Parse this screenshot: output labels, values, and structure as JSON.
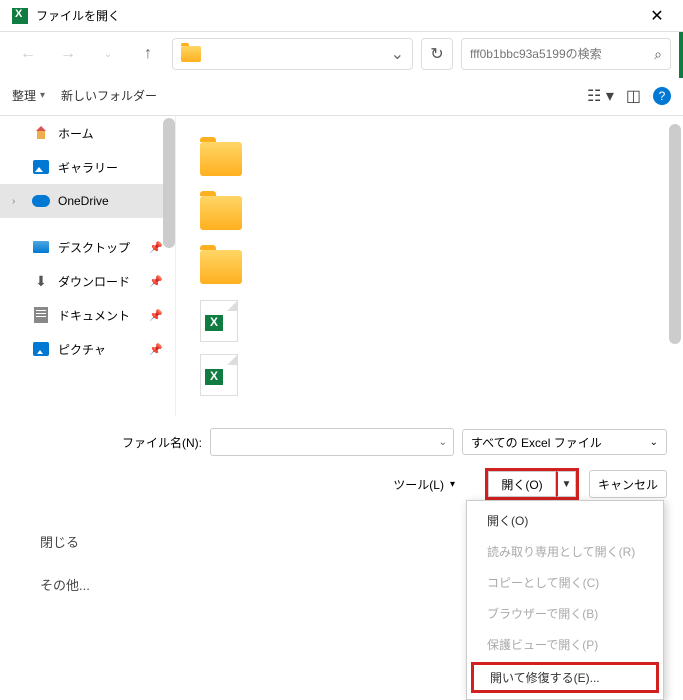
{
  "title": "ファイルを開く",
  "search": {
    "placeholder": "fff0b1bbc93a5199の検索"
  },
  "toolbar": {
    "organize": "整理",
    "newfolder": "新しいフォルダー"
  },
  "sidebar": [
    {
      "label": "ホーム",
      "icon": "house"
    },
    {
      "label": "ギャラリー",
      "icon": "gallery"
    },
    {
      "label": "OneDrive",
      "icon": "onedrive",
      "selected": true,
      "expandable": true
    },
    {
      "sep": true
    },
    {
      "label": "デスクトップ",
      "icon": "desktop",
      "pinned": true
    },
    {
      "label": "ダウンロード",
      "icon": "download",
      "pinned": true
    },
    {
      "label": "ドキュメント",
      "icon": "doc",
      "pinned": true
    },
    {
      "label": "ピクチャ",
      "icon": "pic",
      "pinned": true
    }
  ],
  "files": [
    {
      "type": "folder"
    },
    {
      "type": "folder"
    },
    {
      "type": "folder"
    },
    {
      "type": "excel"
    },
    {
      "type": "excel"
    }
  ],
  "filename_label": "ファイル名(N):",
  "filetype": "すべての Excel ファイル",
  "tools_label": "ツール(L)",
  "open_label": "開く(O)",
  "cancel_label": "キャンセル",
  "menu": [
    {
      "label": "開く(O)"
    },
    {
      "label": "読み取り専用として開く(R)",
      "disabled": true
    },
    {
      "label": "コピーとして開く(C)",
      "disabled": true
    },
    {
      "label": "ブラウザーで開く(B)",
      "disabled": true
    },
    {
      "label": "保護ビューで開く(P)",
      "disabled": true
    },
    {
      "label": "開いて修復する(E)...",
      "highlighted": true
    }
  ],
  "backstage": {
    "close": "閉じる",
    "other": "その他..."
  }
}
